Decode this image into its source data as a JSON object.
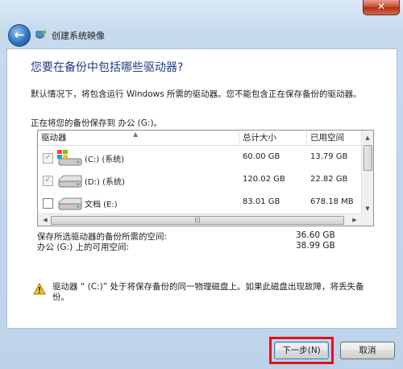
{
  "window": {
    "close_label": "✕"
  },
  "nav": {
    "title": "创建系统映像"
  },
  "heading": "您要在备份中包括哪些驱动器?",
  "description": "默认情况下，将包含运行 Windows 所需的驱动器。您不能包含正在保存备份的驱动器。",
  "save_location": "正在将您的备份保存到 办公 (G:)。",
  "table": {
    "columns": [
      "驱动器",
      "总计大小",
      "已用空间"
    ],
    "rows": [
      {
        "name": "(C:) (系统)",
        "total": "60.00 GB",
        "used": "13.79 GB",
        "checked": true,
        "disabled": true,
        "icon": "windows-drive-icon"
      },
      {
        "name": "(D:) (系统)",
        "total": "120.02 GB",
        "used": "22.82 GB",
        "checked": true,
        "disabled": true,
        "icon": "hard-drive-icon"
      },
      {
        "name": "文档 (E:)",
        "total": "83.01 GB",
        "used": "678.18 MB",
        "checked": false,
        "disabled": false,
        "icon": "hard-drive-icon"
      }
    ]
  },
  "space": {
    "required_label": "保存所选驱动器的备份所需的空间:",
    "required_value": "36.60 GB",
    "available_label": "办公 (G:) 上的可用空间:",
    "available_value": "38.99 GB"
  },
  "warning": "驱动器 “ (C:)” 处于将保存备份的同一物理磁盘上。如果此磁盘出现故障，将丢失备份。",
  "buttons": {
    "next": "下一步(N)",
    "cancel": "取消"
  },
  "colors": {
    "heading": "#1e3b8a",
    "highlight": "#e0121b",
    "close": "#c7452c"
  }
}
